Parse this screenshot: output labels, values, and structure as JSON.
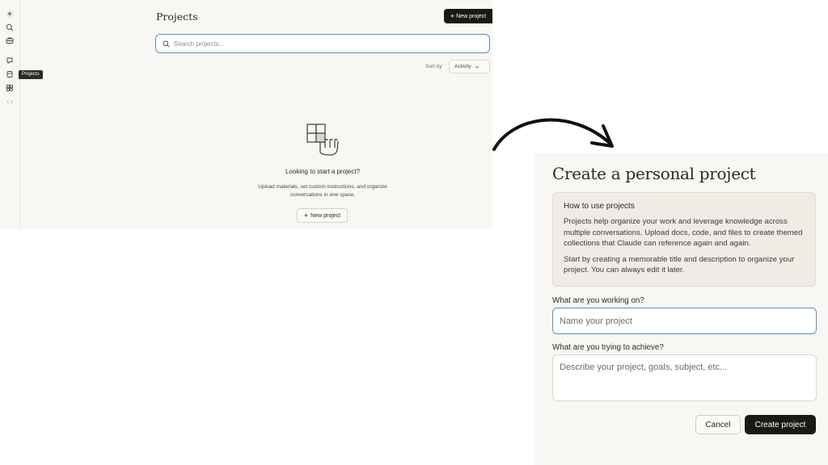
{
  "projects_page": {
    "sidebar": {
      "tooltip": "Projects",
      "icons": [
        "new-chat-icon",
        "search-icon",
        "briefcase-icon",
        "chats-icon",
        "projects-icon",
        "artifacts-icon",
        "code-icon"
      ]
    },
    "title": "Projects",
    "new_project_button": "New project",
    "search": {
      "placeholder": "Search projects..."
    },
    "sort": {
      "label": "Sort by",
      "value": "Activity"
    },
    "empty_state": {
      "title": "Looking to start a project?",
      "description": "Upload materials, set custom instructions, and organize conversations in one space.",
      "button": "New project"
    }
  },
  "dialog": {
    "title": "Create a personal project",
    "help": {
      "heading": "How to use projects",
      "paragraph1": "Projects help organize your work and leverage knowledge across multiple conversations. Upload docs, code, and files to create themed collections that Claude can reference again and again.",
      "paragraph2": "Start by creating a memorable title and description to organize your project. You can always edit it later."
    },
    "name_label": "What are you working on?",
    "name_placeholder": "Name your project",
    "goal_label": "What are you trying to achieve?",
    "goal_placeholder": "Describe your project, goals, subject, etc...",
    "cancel": "Cancel",
    "create": "Create project"
  },
  "colors": {
    "background": "#f8f7f3",
    "accent_focus": "#5b8ec9",
    "primary_button": "#1a1915"
  }
}
